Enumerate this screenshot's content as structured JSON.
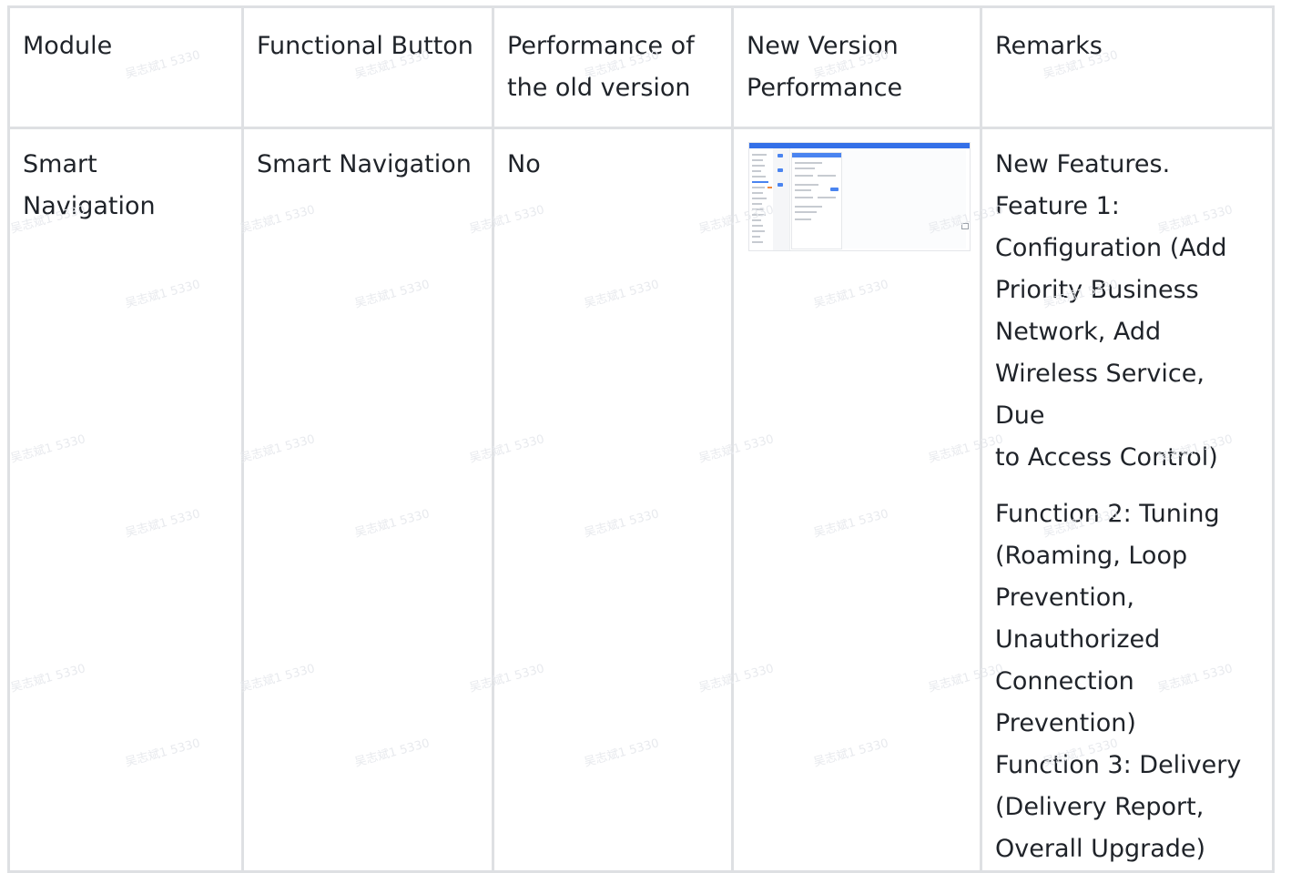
{
  "table": {
    "headers": [
      [
        "Module"
      ],
      [
        "Functional Button"
      ],
      [
        "Performance of",
        "the old version"
      ],
      [
        "New Version",
        "Performance"
      ],
      [
        "Remarks"
      ]
    ],
    "row": {
      "module": [
        "Smart",
        "Navigation"
      ],
      "functional_button": "Smart Navigation",
      "old_version": "No",
      "new_version_image_alt": "screenshot-thumbnail",
      "remarks_block1": [
        "New Features.",
        "Feature 1:",
        "Configuration (Add",
        "Priority Business",
        "Network, Add",
        "Wireless Service, Due",
        "to Access Control)"
      ],
      "remarks_block2": [
        "Function 2: Tuning",
        "(Roaming, Loop",
        "Prevention,",
        "Unauthorized",
        "Connection",
        "Prevention)",
        "Function 3: Delivery",
        "(Delivery Report,",
        "Overall Upgrade)"
      ]
    }
  },
  "colors": {
    "border": "#dee0e3",
    "text": "#1f2329",
    "thumb_accent": "#3470e8"
  },
  "watermark_text": "吴志斌1 5330"
}
